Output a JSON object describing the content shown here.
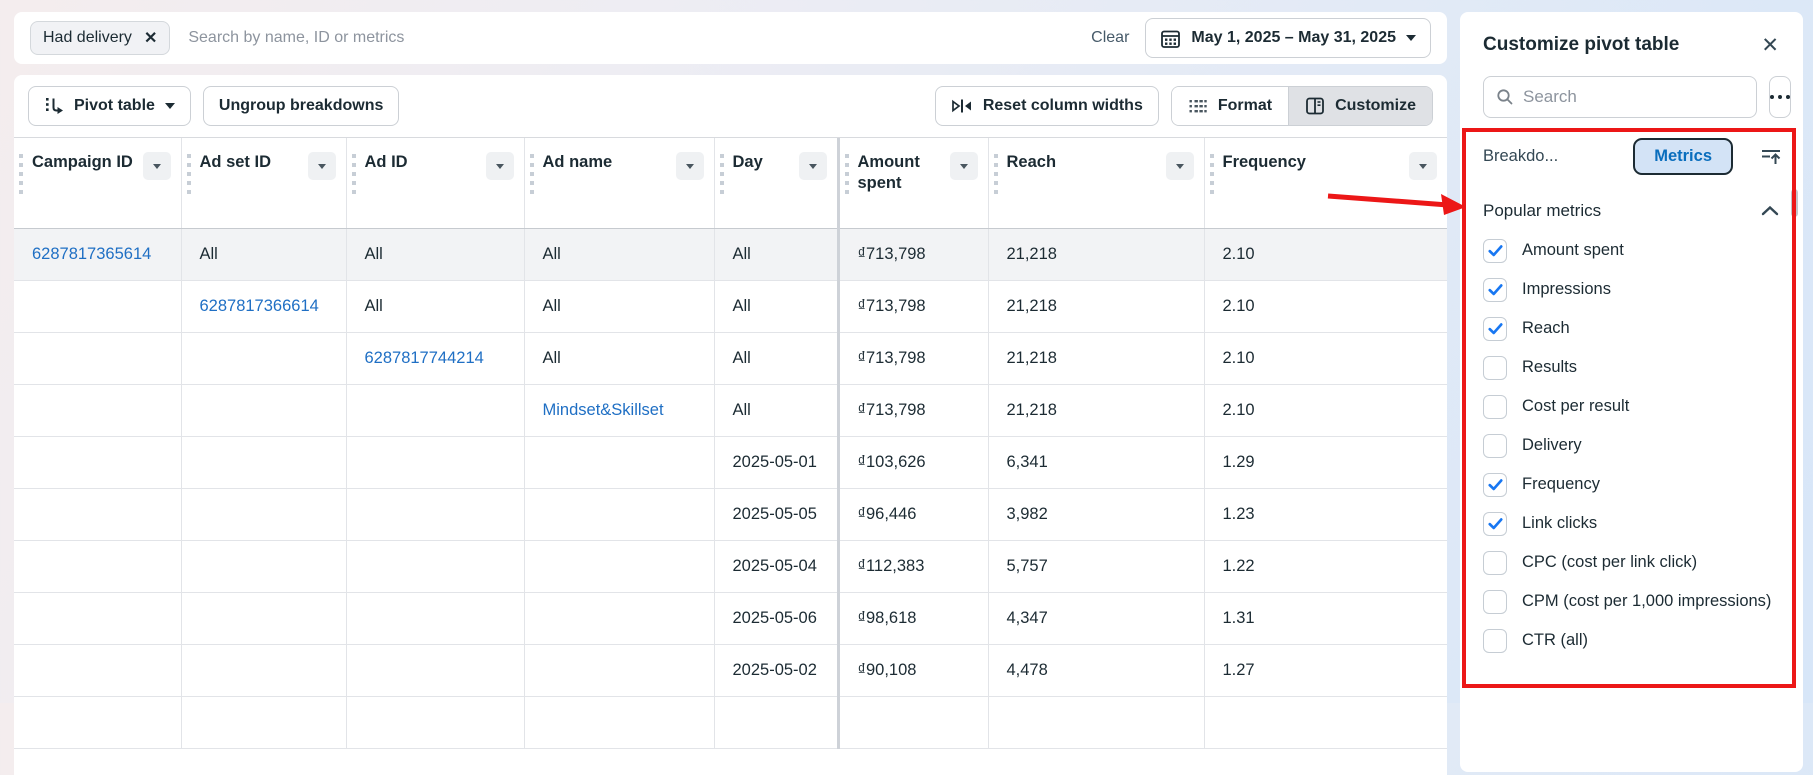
{
  "filter_bar": {
    "chip_label": "Had delivery",
    "search_placeholder": "Search by name, ID or metrics",
    "clear_label": "Clear",
    "date_range": "May 1, 2025 – May 31, 2025"
  },
  "toolbar": {
    "pivot_table_label": "Pivot table",
    "ungroup_label": "Ungroup breakdowns",
    "reset_label": "Reset column widths",
    "format_label": "Format",
    "customize_label": "Customize"
  },
  "table": {
    "columns": [
      "Campaign ID",
      "Ad set ID",
      "Ad ID",
      "Ad name",
      "Day",
      "Amount spent",
      "Reach",
      "Frequency"
    ],
    "rows": [
      {
        "highlight": true,
        "cells": [
          {
            "v": "6287817365614",
            "link": true
          },
          {
            "v": "All"
          },
          {
            "v": "All"
          },
          {
            "v": "All"
          },
          {
            "v": "All"
          },
          {
            "v": "₫713,798"
          },
          {
            "v": "21,218"
          },
          {
            "v": "2.10"
          }
        ]
      },
      {
        "cells": [
          {
            "v": ""
          },
          {
            "v": "6287817366614",
            "link": true
          },
          {
            "v": "All"
          },
          {
            "v": "All"
          },
          {
            "v": "All"
          },
          {
            "v": "₫713,798"
          },
          {
            "v": "21,218"
          },
          {
            "v": "2.10"
          }
        ]
      },
      {
        "cells": [
          {
            "v": ""
          },
          {
            "v": ""
          },
          {
            "v": "6287817744214",
            "link": true
          },
          {
            "v": "All"
          },
          {
            "v": "All"
          },
          {
            "v": "₫713,798"
          },
          {
            "v": "21,218"
          },
          {
            "v": "2.10"
          }
        ]
      },
      {
        "cells": [
          {
            "v": ""
          },
          {
            "v": ""
          },
          {
            "v": ""
          },
          {
            "v": "Mindset&Skillset",
            "link": true
          },
          {
            "v": "All"
          },
          {
            "v": "₫713,798"
          },
          {
            "v": "21,218"
          },
          {
            "v": "2.10"
          }
        ]
      },
      {
        "cells": [
          {
            "v": ""
          },
          {
            "v": ""
          },
          {
            "v": ""
          },
          {
            "v": ""
          },
          {
            "v": "2025-05-01"
          },
          {
            "v": "₫103,626"
          },
          {
            "v": "6,341"
          },
          {
            "v": "1.29"
          }
        ]
      },
      {
        "cells": [
          {
            "v": ""
          },
          {
            "v": ""
          },
          {
            "v": ""
          },
          {
            "v": ""
          },
          {
            "v": "2025-05-05"
          },
          {
            "v": "₫96,446"
          },
          {
            "v": "3,982"
          },
          {
            "v": "1.23"
          }
        ]
      },
      {
        "cells": [
          {
            "v": ""
          },
          {
            "v": ""
          },
          {
            "v": ""
          },
          {
            "v": ""
          },
          {
            "v": "2025-05-04"
          },
          {
            "v": "₫112,383"
          },
          {
            "v": "5,757"
          },
          {
            "v": "1.22"
          }
        ]
      },
      {
        "cells": [
          {
            "v": ""
          },
          {
            "v": ""
          },
          {
            "v": ""
          },
          {
            "v": ""
          },
          {
            "v": "2025-05-06"
          },
          {
            "v": "₫98,618"
          },
          {
            "v": "4,347"
          },
          {
            "v": "1.31"
          }
        ]
      },
      {
        "cells": [
          {
            "v": ""
          },
          {
            "v": ""
          },
          {
            "v": ""
          },
          {
            "v": ""
          },
          {
            "v": "2025-05-02"
          },
          {
            "v": "₫90,108"
          },
          {
            "v": "4,478"
          },
          {
            "v": "1.27"
          }
        ]
      }
    ]
  },
  "panel": {
    "title": "Customize pivot table",
    "search_placeholder": "Search",
    "tab_breakdowns": "Breakdo...",
    "tab_metrics": "Metrics",
    "section_popular": "Popular metrics",
    "metrics": [
      {
        "label": "Amount spent",
        "checked": true
      },
      {
        "label": "Impressions",
        "checked": true
      },
      {
        "label": "Reach",
        "checked": true
      },
      {
        "label": "Results",
        "checked": false
      },
      {
        "label": "Cost per result",
        "checked": false
      },
      {
        "label": "Delivery",
        "checked": false
      },
      {
        "label": "Frequency",
        "checked": true
      },
      {
        "label": "Link clicks",
        "checked": true
      },
      {
        "label": "CPC (cost per link click)",
        "checked": false
      },
      {
        "label": "CPM (cost per 1,000 impressions)",
        "checked": false
      },
      {
        "label": "CTR (all)",
        "checked": false
      }
    ]
  },
  "colors": {
    "link_blue": "#1f6fc4",
    "checkbox_check_blue": "#1877f2",
    "metrics_tab_text": "#0a6ebd",
    "metrics_tab_bg": "#d3e3f6",
    "annotation_red": "#ec1717",
    "row_highlight": "#f2f3f5"
  }
}
